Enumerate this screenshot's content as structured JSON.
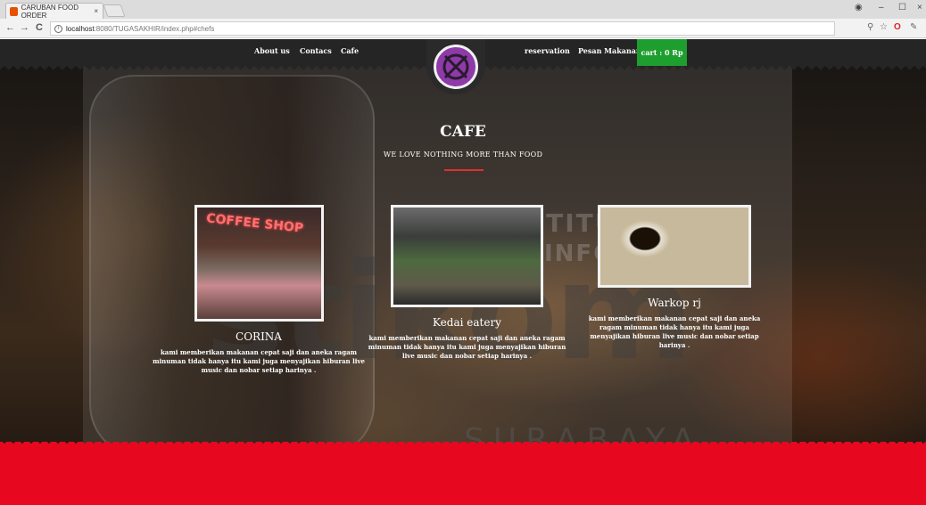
{
  "browser": {
    "tab_title": "CARUBAN FOOD ORDER",
    "tab_close": "×",
    "url_host": "localhost",
    "url_path": ":8080/TUGASAKHIR/index.php#chefs",
    "back": "←",
    "forward": "→",
    "reload": "C",
    "min": "–",
    "restore": "☐",
    "close": "×"
  },
  "nav": {
    "left_links": [
      "About us",
      "Contacs",
      "Cafe"
    ],
    "right_links": [
      "reservation",
      "Pesan Makanan"
    ],
    "cart_label": "cart : 0 Rp",
    "accent_color": "#1e9e2e"
  },
  "section": {
    "title": "CAFE",
    "subtitle": "WE LOVE NOTHING MORE THAN FOOD"
  },
  "cards": [
    {
      "name": "CORINA",
      "sign": "COFFEE SHOP",
      "desc": "kami memberikan makanan cepat saji dan aneka ragam minuman tidak hanya itu kami juga menyajikan hiburan live music dan nobar setiap harinya ."
    },
    {
      "name": "Kedai eatery",
      "desc": "kami memberikan makanan cepat saji dan aneka ragam minuman tidak hanya itu kami juga menyajikan hiburan live music dan nobar setiap harinya ."
    },
    {
      "name": "Warkop rj",
      "desc": "kami memberikan makanan cepat saji dan aneka ragam minuman tidak hanya itu kami juga menyajikan hiburan live music dan nobar setiap harinya ."
    }
  ],
  "watermark": {
    "brand": "stikom",
    "city": "SURABAYA",
    "tag1": "STITUT BISNIS",
    "tag2": "INFORMATIKA"
  },
  "colors": {
    "footer": "#e7071f",
    "logo": "#8e3aa8",
    "divider": "#e03030"
  }
}
